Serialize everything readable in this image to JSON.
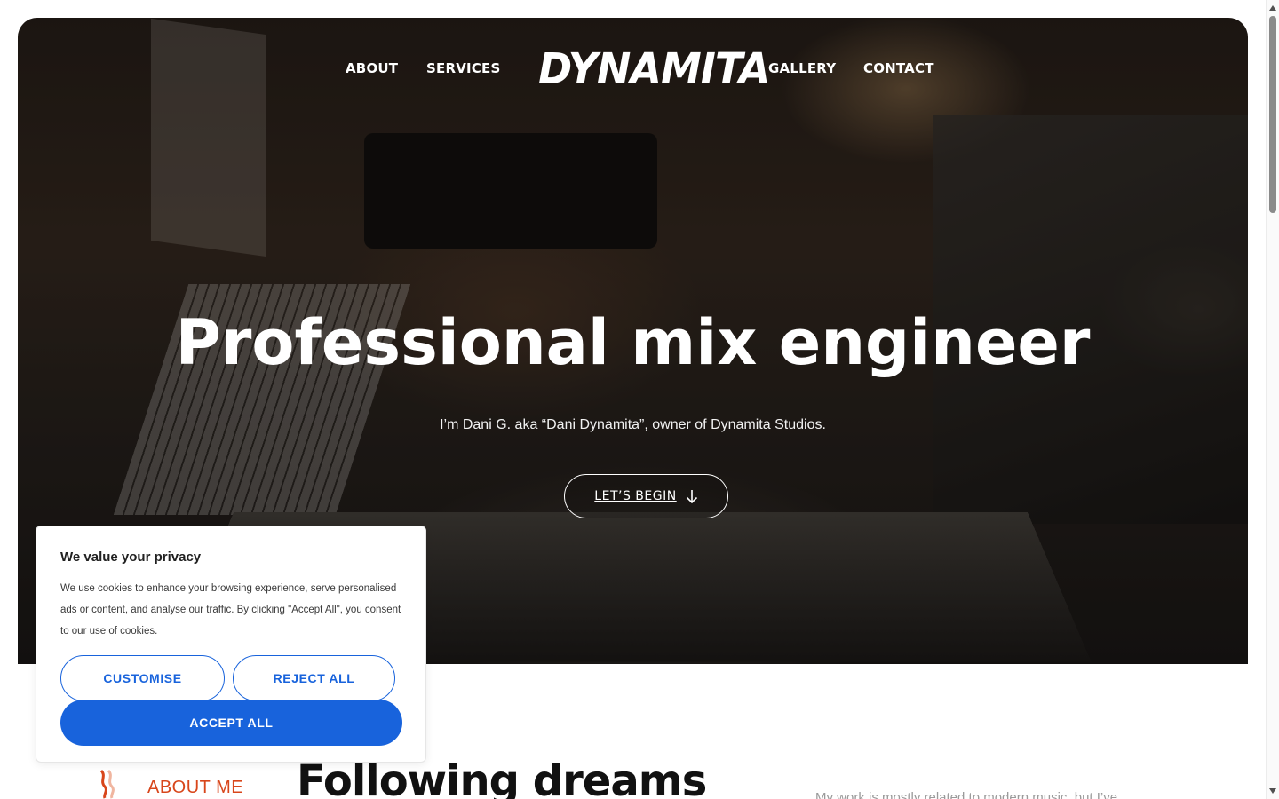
{
  "nav": {
    "about": "ABOUT",
    "services": "SERVICES",
    "logo": "DYNAMITA",
    "gallery": "GALLERY",
    "contact": "CONTACT"
  },
  "hero": {
    "headline": "Professional mix engineer",
    "subline": "I’m Dani G. aka “Dani Dynamita”, owner of Dynamita Studios.",
    "cta_label": "LET’S BEGIN"
  },
  "about": {
    "label": "ABOUT ME",
    "title": "Following dreams",
    "text": "My work is mostly related to modern music, but I’ve"
  },
  "cookie_banner": {
    "title": "We value your privacy",
    "body": "We use cookies to enhance your browsing experience, serve personalised ads or content, and analyse our traffic. By clicking \"Accept All\", you consent to our use of cookies.",
    "customise": "CUSTOMISE",
    "reject": "REJECT ALL",
    "accept": "ACCEPT ALL"
  },
  "colors": {
    "accent_orange": "#d8461b",
    "cookie_blue": "#1863dc"
  },
  "icons": {
    "cta": "arrow-down-icon",
    "about_mark": "wave-mark-icon"
  }
}
